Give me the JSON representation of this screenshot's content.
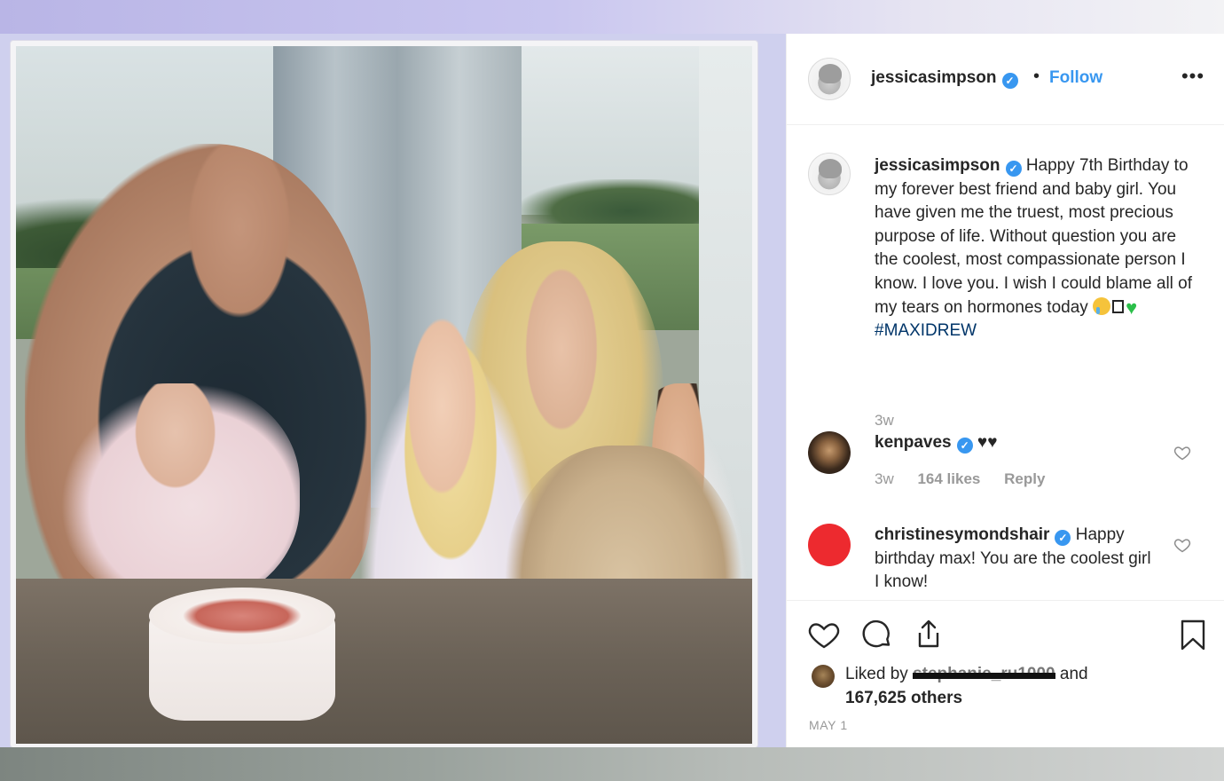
{
  "post": {
    "username": "jessicasimpson",
    "separator": "•",
    "follow_label": "Follow",
    "more_label": "•••",
    "verified_mark": "✓"
  },
  "caption": {
    "username": "jessicasimpson",
    "text": "Happy 7th Birthday to my forever best friend and baby girl. You have given me the truest, most precious purpose of life. Without question you are the coolest, most compassionate person I know. I love you. I wish I could blame all of my tears on hormones today",
    "hashtag": "#MAXIDREW",
    "time": "3w"
  },
  "comments": [
    {
      "username": "kenpaves",
      "text": "♥♥",
      "time": "3w",
      "likes": "164 likes",
      "reply_label": "Reply"
    },
    {
      "username": "christinesymondshair",
      "text": "Happy birthday max! You are the coolest girl I know!"
    }
  ],
  "likes": {
    "prefix": "Liked by",
    "redacted_user": "stephanie_ru1000",
    "middle": "and",
    "count": "167,625 others"
  },
  "date": "MAY 1",
  "icons": {
    "like": "heart-icon",
    "comment": "comment-bubble-icon",
    "share": "share-icon",
    "save": "bookmark-icon",
    "comment_like": "heart-outline-icon"
  },
  "colors": {
    "accent": "#3897f0",
    "hashtag": "#003569",
    "text": "#262626",
    "muted": "#999999"
  }
}
